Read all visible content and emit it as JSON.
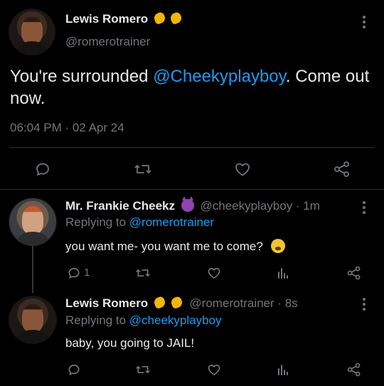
{
  "main_tweet": {
    "name": "Lewis Romero",
    "handle": "@romerotrainer",
    "text_before": "You're surrounded ",
    "mention": "@Cheekyplayboy",
    "text_after": ". Come out now.",
    "timestamp": "06:04 PM · 02 Apr 24"
  },
  "reply1": {
    "name": "Mr. Frankie Cheekz",
    "handle_time": "@cheekyplayboy · 1m",
    "replying_prefix": "Replying to ",
    "replying_to": "@romerotrainer",
    "text": "you want me- you want me to come?",
    "reply_count": "1"
  },
  "reply2": {
    "name": "Lewis Romero",
    "handle_time": "@romerotrainer · 8s",
    "replying_prefix": "Replying to ",
    "replying_to": "@cheekyplayboy",
    "text": "baby, you going to JAIL!"
  },
  "icons": [
    "reply-icon",
    "retweet-icon",
    "like-icon",
    "analytics-icon",
    "share-icon",
    "more-icon"
  ],
  "colors": {
    "background": "#000000",
    "text": "#e7e9ea",
    "muted": "#71767b",
    "link": "#1d9bf0"
  }
}
